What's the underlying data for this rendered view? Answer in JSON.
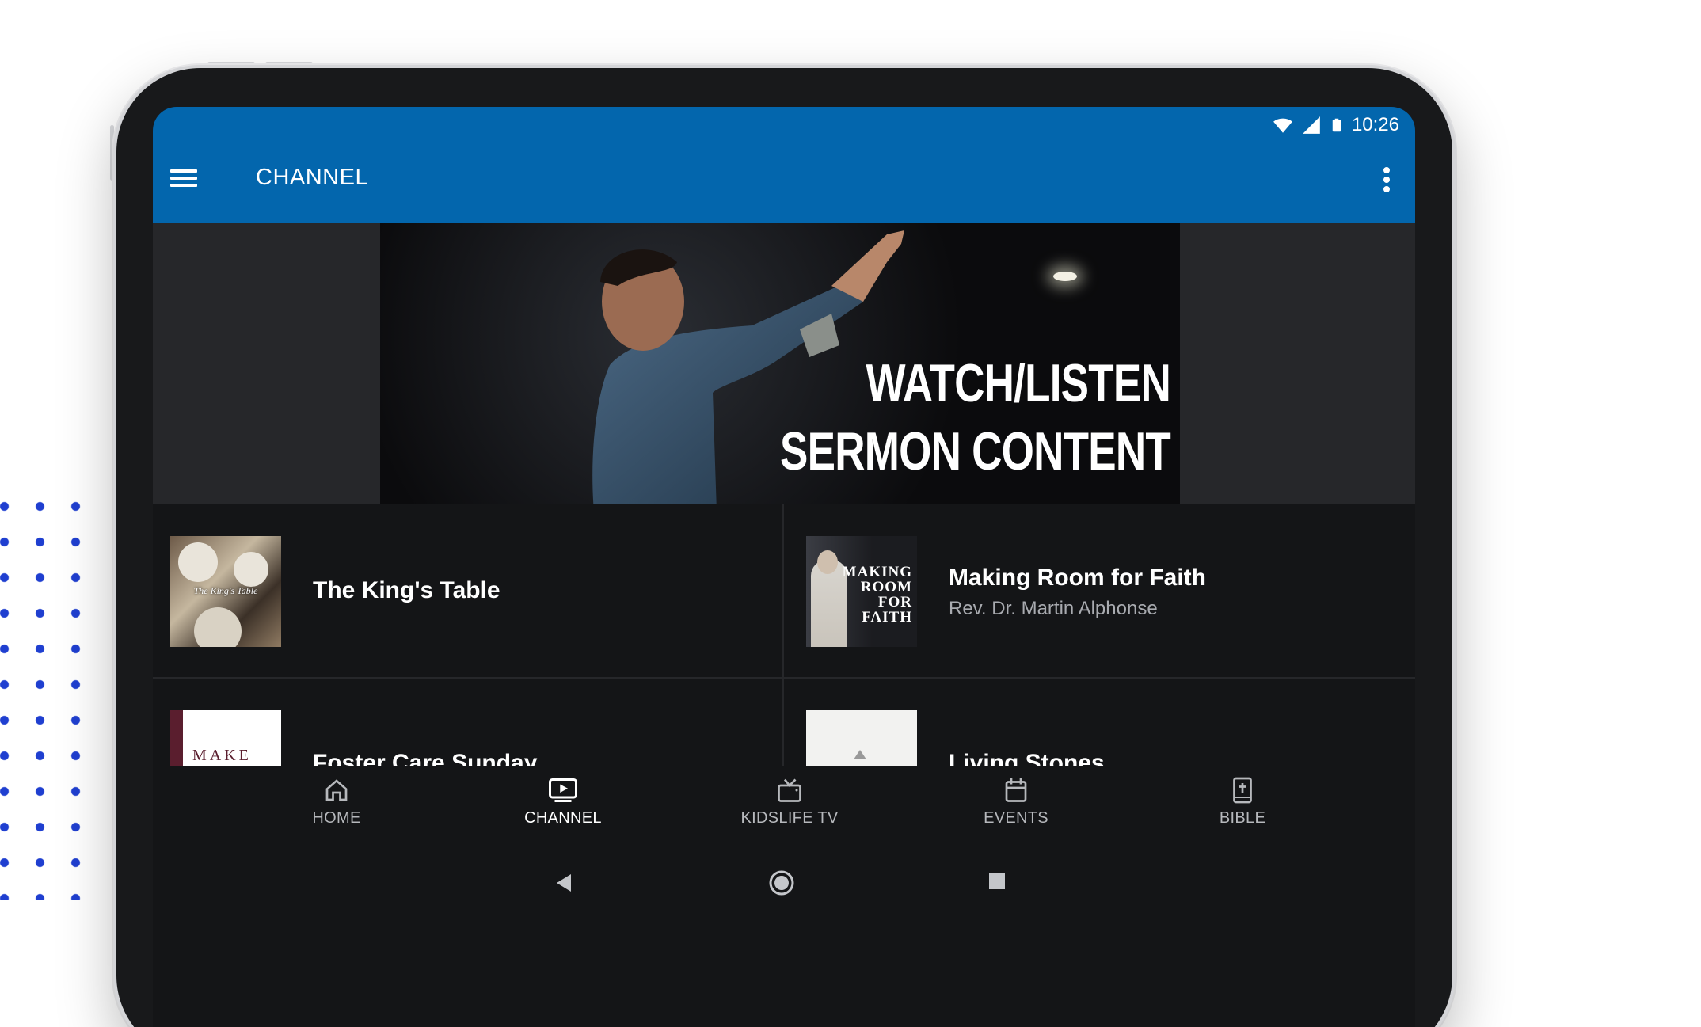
{
  "status_bar": {
    "time": "10:26",
    "icons": [
      "wifi-icon",
      "signal-icon",
      "battery-icon"
    ]
  },
  "app_bar": {
    "title": "CHANNEL",
    "menu_icon": "hamburger-menu-icon",
    "more_icon": "more-vertical-icon",
    "color": "#0366ad"
  },
  "hero": {
    "line1": "WATCH/LISTEN",
    "line2": "SERMON CONTENT"
  },
  "channel_items": [
    {
      "title": "The King's Table",
      "subtitle": "",
      "thumb_text": "The King's Table"
    },
    {
      "title": "Making Room for Faith",
      "subtitle": "Rev. Dr. Martin Alphonse",
      "thumb_text": [
        "MAKING",
        "ROOM",
        "FOR",
        "FAITH"
      ]
    },
    {
      "title": "Foster Care Sunday",
      "subtitle": "",
      "thumb_text": "MAKE"
    },
    {
      "title": "Living Stones",
      "subtitle": "",
      "thumb_text": ""
    }
  ],
  "bottom_nav": [
    {
      "label": "HOME",
      "icon": "home-icon",
      "active": false
    },
    {
      "label": "CHANNEL",
      "icon": "play-screen-icon",
      "active": true
    },
    {
      "label": "KIDSLIFE TV",
      "icon": "tv-icon",
      "active": false
    },
    {
      "label": "EVENTS",
      "icon": "calendar-icon",
      "active": false
    },
    {
      "label": "BIBLE",
      "icon": "bible-icon",
      "active": false
    }
  ],
  "system_nav": [
    "back-icon",
    "home-circle-icon",
    "recents-icon"
  ]
}
